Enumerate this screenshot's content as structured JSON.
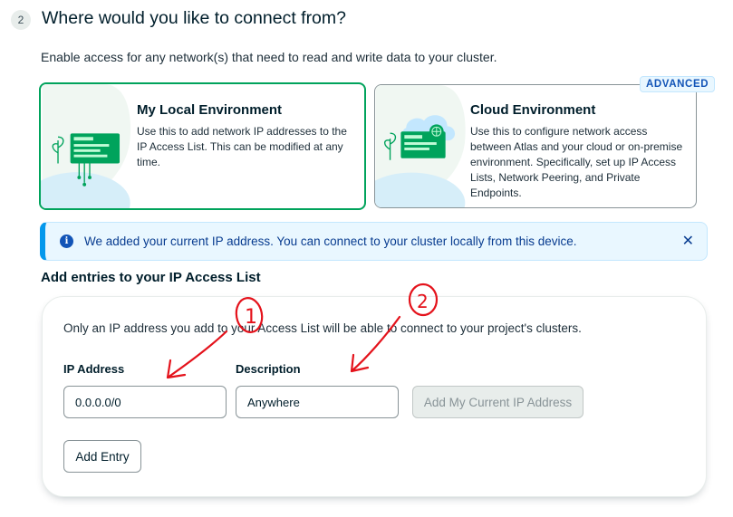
{
  "step": {
    "number": "2",
    "title": "Where would you like to connect from?"
  },
  "subtitle": "Enable access for any network(s) that need to read and write data to your cluster.",
  "environments": {
    "local": {
      "title": "My Local Environment",
      "description": "Use this to add network IP addresses to the IP Access List. This can be modified at any time.",
      "selected": true
    },
    "cloud": {
      "title": "Cloud Environment",
      "badge": "ADVANCED",
      "description": "Use this to configure network access between Atlas and your cloud or on-premise environment. Specifically, set up IP Access Lists, Network Peering, and Private Endpoints.",
      "selected": false
    }
  },
  "banner": {
    "icon": "info-icon",
    "text": "We added your current IP address. You can connect to your cluster locally from this device.",
    "close_icon": "close-icon"
  },
  "access_list": {
    "heading": "Add entries to your IP Access List",
    "note": "Only an IP address you add to your Access List will be able to connect to your project's clusters.",
    "ip_label": "IP Address",
    "ip_value": "0.0.0.0/0",
    "description_label": "Description",
    "description_value": "Anywhere",
    "add_current_ip_label": "Add My Current IP Address",
    "add_entry_label": "Add Entry"
  },
  "annotations": {
    "mark_1": "1",
    "mark_2": "2"
  },
  "colors": {
    "accent_green": "#00a35c",
    "info_blue": "#0498ec",
    "annotation_red": "#e4121b"
  }
}
